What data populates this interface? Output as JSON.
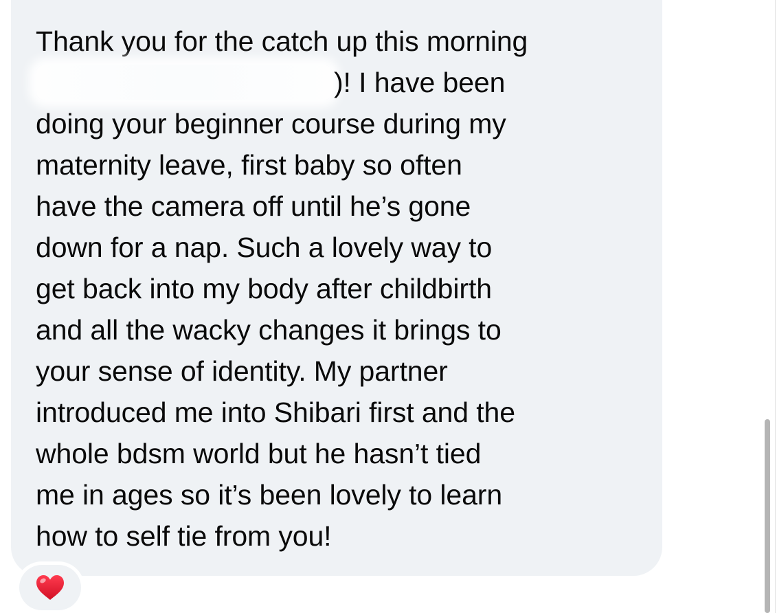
{
  "message": {
    "lines": [
      "Thank you for the catch up this morning",
      ")! I have been",
      "doing your beginner course during my",
      "maternity leave, first baby so often",
      "have the camera off until he’s gone",
      "down for a nap. Such a lovely way to",
      "get back into my body after childbirth",
      "and all the wacky changes it brings to",
      "your sense of identity. My partner",
      "introduced me into Shibari first and the",
      "whole bdsm world but he hasn’t tied",
      "me in ages so it’s been lovely to learn",
      "how to self tie from you!"
    ]
  },
  "reaction": {
    "emoji": "❤️",
    "icon": "red-heart-icon",
    "color": "#e8132b"
  },
  "colors": {
    "bubble": "#eff2f5",
    "text": "#0a0a0a",
    "heart": "#e8132b"
  }
}
